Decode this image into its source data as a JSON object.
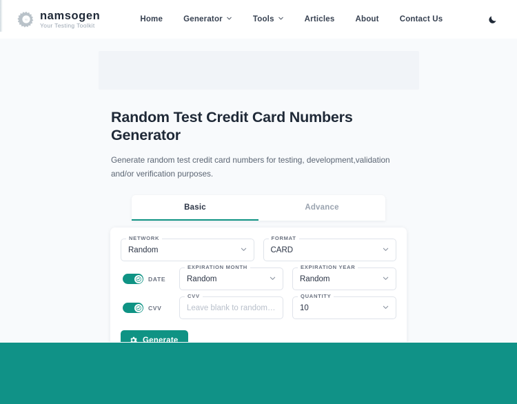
{
  "brand": {
    "name": "namsogen",
    "tagline": "Your Testing Toolkit",
    "logo_icon": "gear-icon"
  },
  "nav": {
    "items": [
      {
        "label": "Home",
        "has_dropdown": false
      },
      {
        "label": "Generator",
        "has_dropdown": true
      },
      {
        "label": "Tools",
        "has_dropdown": true
      },
      {
        "label": "Articles",
        "has_dropdown": false
      },
      {
        "label": "About",
        "has_dropdown": false
      },
      {
        "label": "Contact Us",
        "has_dropdown": false
      }
    ],
    "theme_toggle_icon": "moon-icon"
  },
  "hero": {
    "title": "Random Test Credit Card Numbers Generator",
    "description": "Generate random test credit card numbers for testing, development,validation and/or verification purposes."
  },
  "tabs": [
    {
      "label": "Basic",
      "active": true
    },
    {
      "label": "Advance",
      "active": false
    }
  ],
  "form": {
    "network": {
      "legend": "NETWORK",
      "value": "Random"
    },
    "format": {
      "legend": "FORMAT",
      "value": "CARD"
    },
    "date_toggle": {
      "label": "DATE",
      "on": true
    },
    "expiration_month": {
      "legend": "EXPIRATION MONTH",
      "value": "Random"
    },
    "expiration_year": {
      "legend": "EXPIRATION YEAR",
      "value": "Random"
    },
    "cvv_toggle": {
      "label": "CVV",
      "on": true
    },
    "cvv": {
      "legend": "CVV",
      "value": "",
      "placeholder": "Leave blank to randomize"
    },
    "quantity": {
      "legend": "QUANTITY",
      "value": "10"
    },
    "generate_button": {
      "label": "Generate",
      "icon": "gear-icon"
    }
  },
  "colors": {
    "accent": "#0f9384",
    "footer": "#109287",
    "page_bg": "#f8fafc",
    "text": "#1f2937"
  }
}
